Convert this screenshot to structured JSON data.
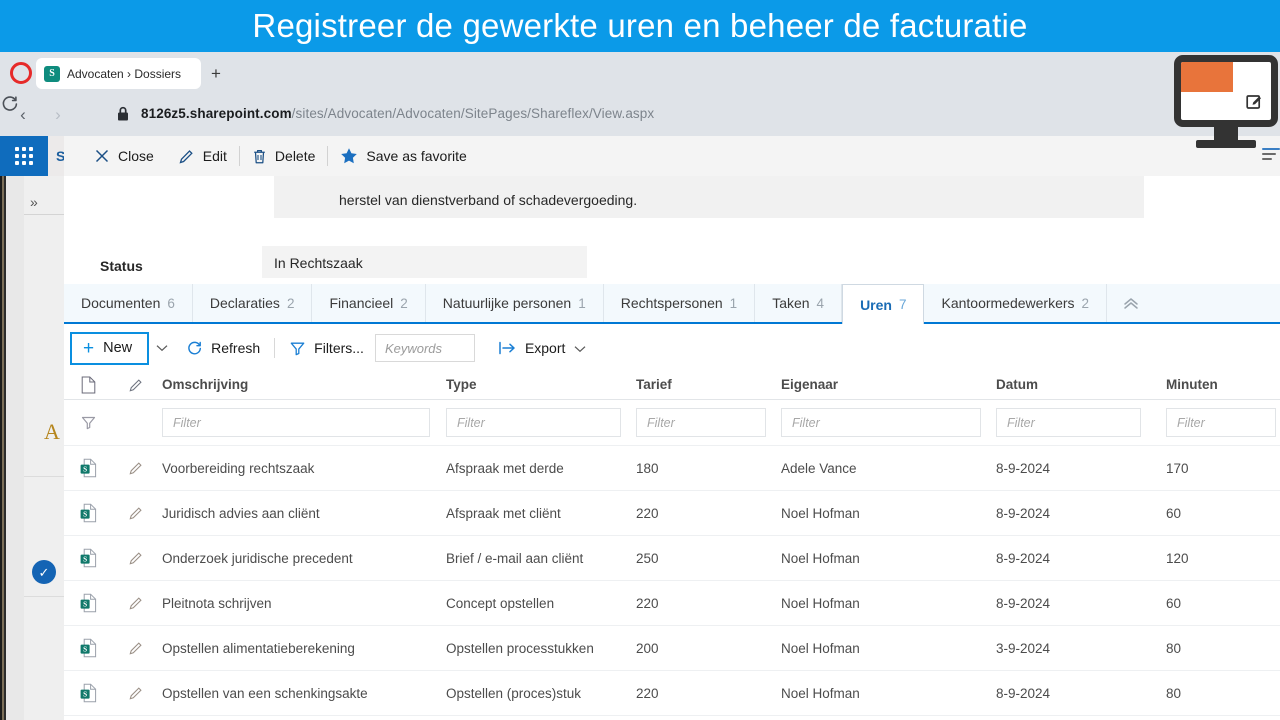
{
  "banner": {
    "text": "Registreer de gewerkte uren en beheer de facturatie",
    "bg": "#0b9ae8"
  },
  "browser": {
    "tab_title": "Advocaten › Dossiers",
    "newtab_label": "+",
    "back_icon": "‹",
    "forward_icon": "›",
    "reload_icon": "reload-icon",
    "url_prefix": "8126z5.",
    "url_domain": "sharepoint.com",
    "url_path": "/sites/Advocaten/Advocaten/SitePages/Shareflex/View.aspx",
    "sharepoint_badge": "S"
  },
  "suitebar": {
    "app_label": "SharePoint"
  },
  "commandbar": {
    "items": [
      {
        "label": "Close",
        "icon": "close-icon"
      },
      {
        "label": "Edit",
        "icon": "edit-pencil-icon"
      },
      {
        "label": "Delete",
        "icon": "trash-icon"
      },
      {
        "label": "Save as favorite",
        "icon": "star-icon"
      }
    ]
  },
  "form": {
    "description_text": "herstel van dienstverband of schadevergoeding.",
    "status_label": "Status",
    "status_value": "In Rechtszaak"
  },
  "tabs": {
    "items": [
      {
        "label": "Documenten",
        "count": "6",
        "active": false
      },
      {
        "label": "Declaraties",
        "count": "2",
        "active": false
      },
      {
        "label": "Financieel",
        "count": "2",
        "active": false
      },
      {
        "label": "Natuurlijke personen",
        "count": "1",
        "active": false
      },
      {
        "label": "Rechtspersonen",
        "count": "1",
        "active": false
      },
      {
        "label": "Taken",
        "count": "4",
        "active": false
      },
      {
        "label": "Uren",
        "count": "7",
        "active": true
      },
      {
        "label": "Kantoormedewerkers",
        "count": "2",
        "active": false
      }
    ],
    "collapse_icon": "double-chevron-up-icon",
    "active_color": "#1a6cb5"
  },
  "toolbar": {
    "new_label": "New",
    "new_plus": "+",
    "dropdown_icon": "chevron-down-icon",
    "refresh_label": "Refresh",
    "filters_label": "Filters...",
    "keywords_placeholder": "Keywords",
    "keywords_value": "",
    "export_label": "Export",
    "focus_color": "#0a8fe0"
  },
  "grid": {
    "headers": {
      "icon": "document-icon",
      "pencil": "edit-pencil-icon",
      "omschrijving": "Omschrijving",
      "type": "Type",
      "tarief": "Tarief",
      "eigenaar": "Eigenaar",
      "datum": "Datum",
      "minuten": "Minuten"
    },
    "filter_row": {
      "funnel_icon": "filter-funnel-icon",
      "placeholder": "Filter"
    },
    "rows": [
      {
        "omschrijving": "Voorbereiding rechtszaak",
        "type": "Afspraak met derde",
        "tarief": "180",
        "eigenaar": "Adele Vance",
        "datum": "8-9-2024",
        "minuten": "170"
      },
      {
        "omschrijving": "Juridisch advies aan cliënt",
        "type": "Afspraak met cliënt",
        "tarief": "220",
        "eigenaar": "Noel Hofman",
        "datum": "8-9-2024",
        "minuten": "60"
      },
      {
        "omschrijving": "Onderzoek juridische precedent",
        "type": "Brief / e-mail aan cliënt",
        "tarief": "250",
        "eigenaar": "Noel Hofman",
        "datum": "8-9-2024",
        "minuten": "120"
      },
      {
        "omschrijving": "Pleitnota schrijven",
        "type": "Concept opstellen",
        "tarief": "220",
        "eigenaar": "Noel Hofman",
        "datum": "8-9-2024",
        "minuten": "60"
      },
      {
        "omschrijving": "Opstellen alimentatieberekening",
        "type": "Opstellen processtukken",
        "tarief": "200",
        "eigenaar": "Noel Hofman",
        "datum": "3-9-2024",
        "minuten": "80"
      },
      {
        "omschrijving": "Opstellen van een schenkingsakte",
        "type": "Opstellen (proces)stuk",
        "tarief": "220",
        "eigenaar": "Noel Hofman",
        "datum": "8-9-2024",
        "minuten": "80"
      }
    ]
  },
  "background_list": {
    "expand_icon": "double-chevron-right-icon",
    "pencil_icon": "edit-pencil-icon",
    "group_letter": "A",
    "selected_check_icon": "check-circle-icon"
  },
  "overlay": {
    "monitor_icon": "monitor-screen-icon",
    "badge_icon": "screen-edit-badge-icon",
    "accent": "#e8743b"
  }
}
